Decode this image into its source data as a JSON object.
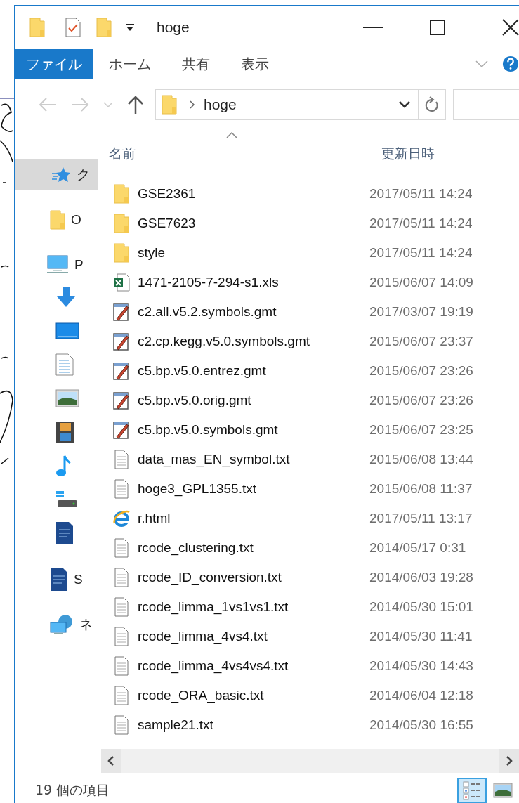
{
  "window": {
    "title": "hoge"
  },
  "ribbon_tabs": [
    {
      "label": "ファイル",
      "selected": true
    },
    {
      "label": "ホーム",
      "selected": false
    },
    {
      "label": "共有",
      "selected": false
    },
    {
      "label": "表示",
      "selected": false
    }
  ],
  "address": {
    "path": "hoge"
  },
  "columns": [
    "名前",
    "更新日時"
  ],
  "sidebar": {
    "items": [
      {
        "kind": "star",
        "label": "ク",
        "selected": true
      },
      {
        "kind": "folder",
        "label": "O",
        "selected": false
      },
      {
        "kind": "pc",
        "label": "P",
        "selected": false,
        "children": [
          {
            "kind": "download",
            "selected": false
          },
          {
            "kind": "desktop",
            "selected": false
          },
          {
            "kind": "documents",
            "selected": false
          },
          {
            "kind": "pictures",
            "selected": false
          },
          {
            "kind": "videos",
            "selected": false
          },
          {
            "kind": "music",
            "selected": false
          },
          {
            "kind": "drive",
            "selected": false
          },
          {
            "kind": "sdcard",
            "selected": false
          }
        ]
      },
      {
        "kind": "sdcard",
        "label": "S",
        "selected": false
      },
      {
        "kind": "network",
        "label": "ネ",
        "selected": false
      }
    ]
  },
  "files": [
    {
      "kind": "folder",
      "name": "GSE2361",
      "modified": "2017/05/11 14:24"
    },
    {
      "kind": "folder",
      "name": "GSE7623",
      "modified": "2017/05/11 14:24"
    },
    {
      "kind": "folder",
      "name": "style",
      "modified": "2017/05/11 14:24"
    },
    {
      "kind": "excel",
      "name": "1471-2105-7-294-s1.xls",
      "modified": "2015/06/07 14:09"
    },
    {
      "kind": "gmt",
      "name": "c2.all.v5.2.symbols.gmt",
      "modified": "2017/03/07 19:19"
    },
    {
      "kind": "gmt",
      "name": "c2.cp.kegg.v5.0.symbols.gmt",
      "modified": "2015/06/07 23:37"
    },
    {
      "kind": "gmt",
      "name": "c5.bp.v5.0.entrez.gmt",
      "modified": "2015/06/07 23:26"
    },
    {
      "kind": "gmt",
      "name": "c5.bp.v5.0.orig.gmt",
      "modified": "2015/06/07 23:26"
    },
    {
      "kind": "gmt",
      "name": "c5.bp.v5.0.symbols.gmt",
      "modified": "2015/06/07 23:25"
    },
    {
      "kind": "text",
      "name": "data_mas_EN_symbol.txt",
      "modified": "2015/06/08 13:44"
    },
    {
      "kind": "text",
      "name": "hoge3_GPL1355.txt",
      "modified": "2015/06/08 11:37"
    },
    {
      "kind": "html",
      "name": "r.html",
      "modified": "2017/05/11 13:17"
    },
    {
      "kind": "text",
      "name": "rcode_clustering.txt",
      "modified": "2014/05/17 0:31"
    },
    {
      "kind": "text",
      "name": "rcode_ID_conversion.txt",
      "modified": "2014/06/03 19:28"
    },
    {
      "kind": "text",
      "name": "rcode_limma_1vs1vs1.txt",
      "modified": "2014/05/30 15:01"
    },
    {
      "kind": "text",
      "name": "rcode_limma_4vs4.txt",
      "modified": "2014/05/30 11:41"
    },
    {
      "kind": "text",
      "name": "rcode_limma_4vs4vs4.txt",
      "modified": "2014/05/30 14:43"
    },
    {
      "kind": "text",
      "name": "rcode_ORA_basic.txt",
      "modified": "2014/06/04 12:18"
    },
    {
      "kind": "text",
      "name": "sample21.txt",
      "modified": "2014/05/30 16:55"
    }
  ],
  "status_bar": {
    "item_count": "19 個の項目"
  },
  "view_buttons": [
    {
      "kind": "details",
      "selected": true
    },
    {
      "kind": "thumbnails",
      "selected": false
    }
  ]
}
